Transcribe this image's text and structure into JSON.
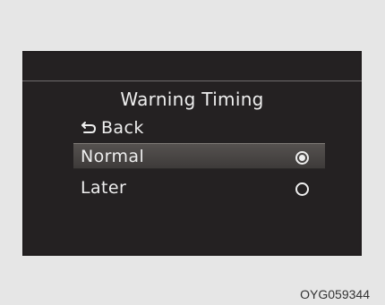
{
  "menu": {
    "title": "Warning Timing",
    "back_label": "Back",
    "items": [
      {
        "label": "Normal",
        "selected": true
      },
      {
        "label": "Later",
        "selected": false
      }
    ]
  },
  "caption": "OYG059344",
  "colors": {
    "screen_background": "#242122",
    "highlight": "#4a4644",
    "text": "#eeeeee",
    "page_background": "#e6e6e6"
  },
  "icons": {
    "back": "back-arrow-icon",
    "radio_on": "radio-selected-icon",
    "radio_off": "radio-unselected-icon"
  }
}
